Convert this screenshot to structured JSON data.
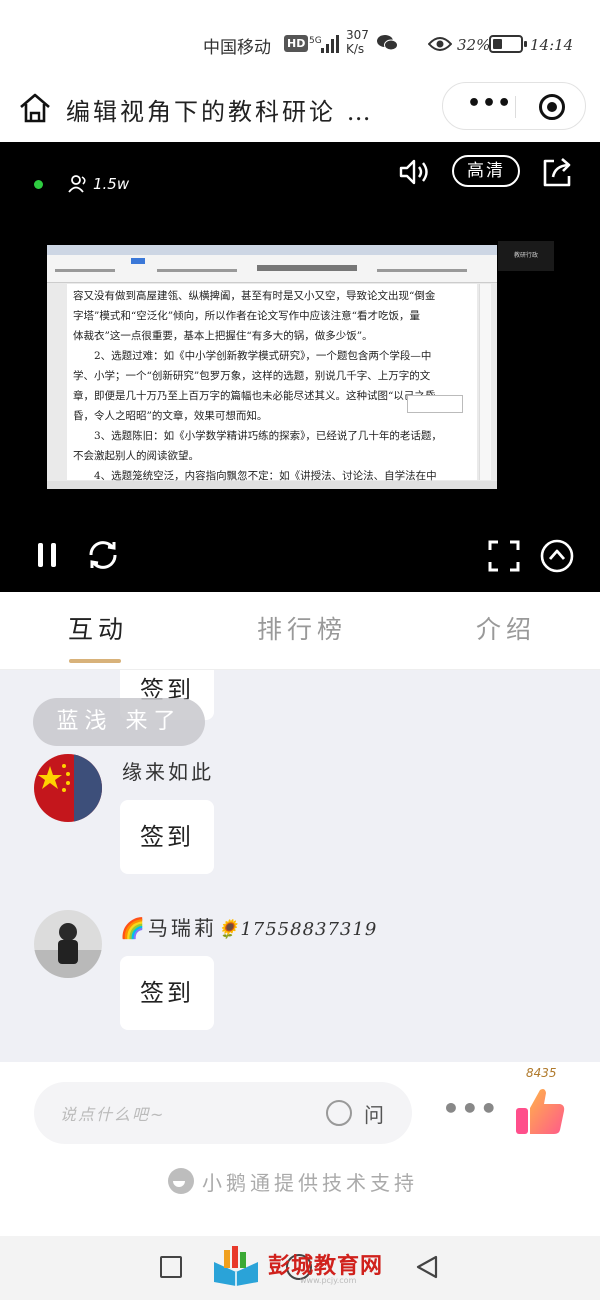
{
  "status_bar": {
    "carrier": "中国移动",
    "hd": "HD",
    "network": "5G",
    "speed_value": "307",
    "speed_unit": "K/s",
    "battery": "32%",
    "battery_level": 0.32,
    "time": "14:14"
  },
  "header": {
    "title": "编辑视角下的教科研论 …"
  },
  "player": {
    "viewers": "1.5w",
    "quality_label": "高清",
    "side_tag": "教研行政"
  },
  "doc": {
    "lines": [
      "容又没有做到高屋建瓴、纵横捭阖，甚至有时是又小又空，导致论文出现“倒金",
      "字塔”模式和“空泛化”倾向，所以作者在论文写作中应该注意“看才吃饭，量",
      "体裁衣”这一点很重要，基本上把握住“有多大的锅，做多少饭”。",
      "　　2、选题过难：如《中小学创新教学模式研究》，一个题包含两个学段—中",
      "学、小学；一个“创新研究”包罗万象，这样的选题，别说几千字、上万字的文",
      "章，即便是几十万乃至上百万字的篇幅也未必能尽述其义。这种试图“以己之昏",
      "昏，令人之昭昭”的文章，效果可想而知。",
      "　　3、选题陈旧：如《小学数学精讲巧练的探索》，已经说了几十年的老话题，",
      "不会激起别人的阅读欲望。",
      "　　4、选题笼统空泛，内容指向飘忽不定：如《讲授法、讨论法、自学法在中"
    ]
  },
  "tabs": [
    {
      "label": "互动"
    },
    {
      "label": "排行榜"
    },
    {
      "label": "介绍"
    }
  ],
  "chat": {
    "entrance_notice": "蓝浅 来了",
    "messages": [
      {
        "user": "",
        "text": "签到"
      },
      {
        "user": "缘来如此",
        "text": "签到"
      },
      {
        "user_prefix": "🌈",
        "user": "马瑞莉",
        "user_suffix": "🌻17558837319",
        "text": "签到"
      }
    ]
  },
  "input": {
    "placeholder": "说点什么吧~",
    "question_label": "问",
    "like_count": "8435"
  },
  "footer": {
    "support": "小鹅通提供技术支持"
  },
  "watermark": {
    "text": "彭城教育网",
    "sub": "www.pcjy.com"
  },
  "colors": {
    "accent": "#d8b27a",
    "live": "#2ecc40",
    "watermark": "#d0211c"
  }
}
